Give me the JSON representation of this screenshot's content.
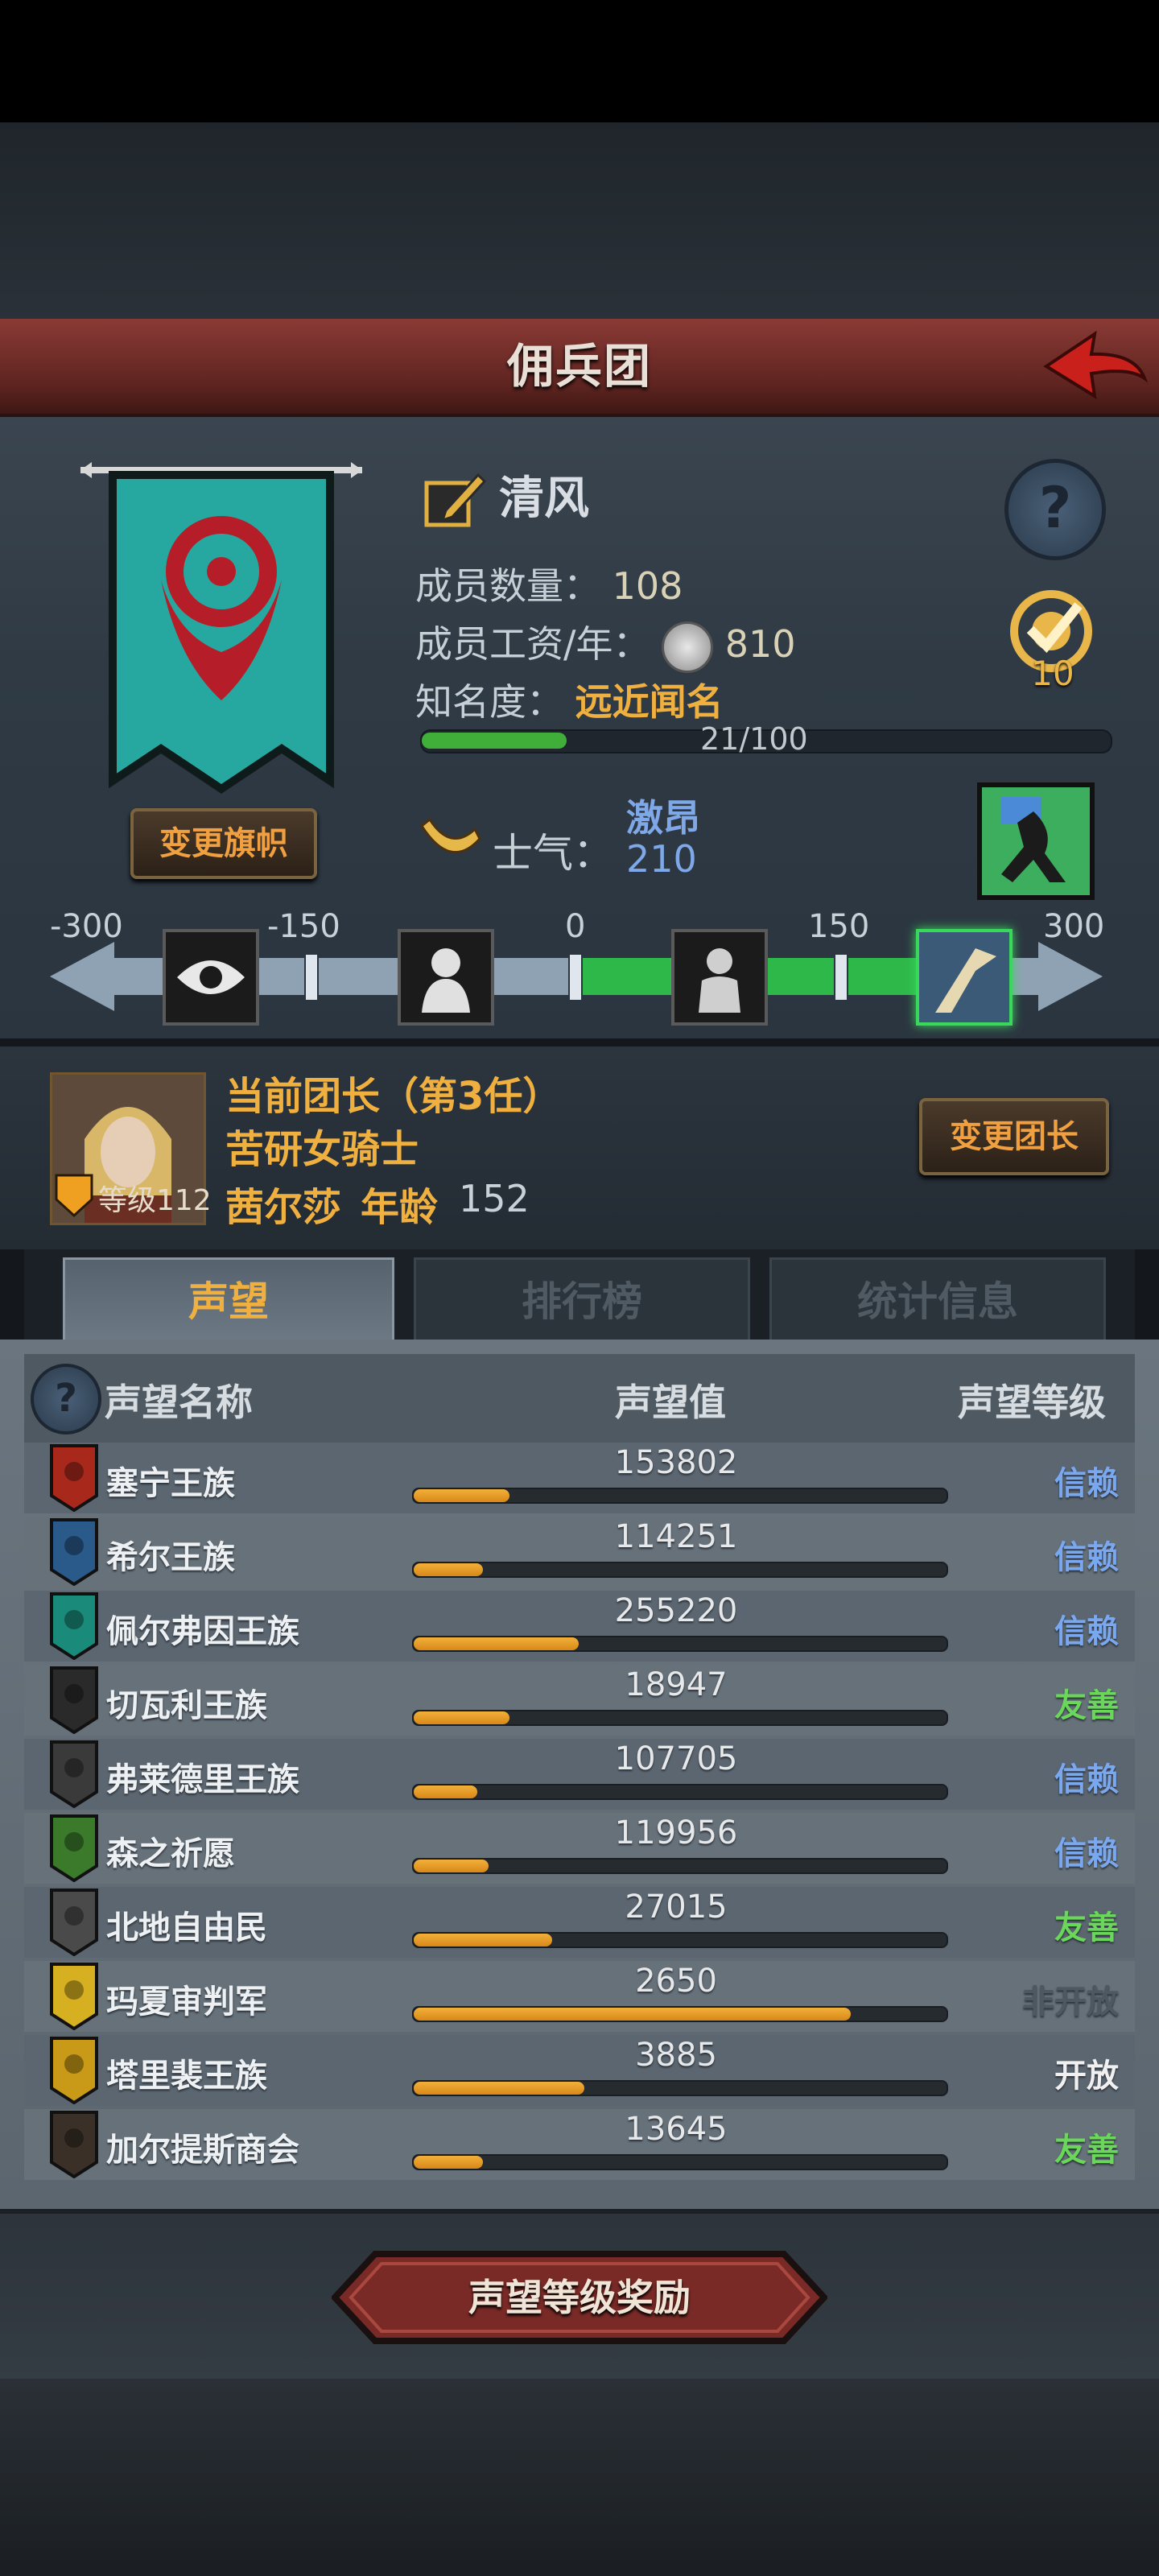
{
  "header": {
    "title": "佣兵团"
  },
  "company": {
    "name": "清风",
    "members_label": "成员数量：",
    "members": "108",
    "wage_label": "成员工资/年：",
    "wage": "810",
    "fame_label": "知名度：",
    "fame_value": "远近闻名",
    "fame_progress_text": "21/100",
    "fame_progress": 0.21,
    "task_count": "10",
    "change_flag_label": "变更旗帜"
  },
  "morale": {
    "label": "士气：",
    "state": "激昂",
    "value": "210",
    "scale_labels": [
      "-300",
      "-150",
      "0",
      "150",
      "300"
    ]
  },
  "leader": {
    "title": "当前团长（第3任）",
    "subtitle": "苦研女骑士",
    "name": "茜尔莎",
    "age_label": "年龄",
    "age": "152",
    "level": "等级112",
    "change_label": "变更团长"
  },
  "tabs": [
    {
      "label": "声望"
    },
    {
      "label": "排行榜"
    },
    {
      "label": "统计信息"
    }
  ],
  "reputation": {
    "headers": {
      "name": "声望名称",
      "value": "声望值",
      "level": "声望等级"
    },
    "rows": [
      {
        "name": "塞宁王族",
        "value": "153802",
        "level": "信赖",
        "fill": 0.18,
        "color": "#79a8f0",
        "crest_color": "#a8281c"
      },
      {
        "name": "希尔王族",
        "value": "114251",
        "level": "信赖",
        "fill": 0.13,
        "color": "#79a8f0",
        "crest_color": "#2a5a8a"
      },
      {
        "name": "佩尔弗因王族",
        "value": "255220",
        "level": "信赖",
        "fill": 0.31,
        "color": "#79a8f0",
        "crest_color": "#1a8a7a"
      },
      {
        "name": "切瓦利王族",
        "value": "18947",
        "level": "友善",
        "fill": 0.18,
        "color": "#6ad65a",
        "crest_color": "#2a2a2a"
      },
      {
        "name": "弗莱德里王族",
        "value": "107705",
        "level": "信赖",
        "fill": 0.12,
        "color": "#79a8f0",
        "crest_color": "#3a3a3a"
      },
      {
        "name": "森之祈愿",
        "value": "119956",
        "level": "信赖",
        "fill": 0.14,
        "color": "#79a8f0",
        "crest_color": "#3a7a2a"
      },
      {
        "name": "北地自由民",
        "value": "27015",
        "level": "友善",
        "fill": 0.26,
        "color": "#6ad65a",
        "crest_color": "#4a4a4a"
      },
      {
        "name": "玛夏审判军",
        "value": "2650",
        "level": "非开放",
        "fill": 0.82,
        "color": "#4e5860",
        "crest_color": "#d6b020"
      },
      {
        "name": "塔里裴王族",
        "value": "3885",
        "level": "开放",
        "fill": 0.32,
        "color": "#f0f0f0",
        "crest_color": "#c89a18"
      },
      {
        "name": "加尔提斯商会",
        "value": "13645",
        "level": "友善",
        "fill": 0.13,
        "color": "#6ad65a",
        "crest_color": "#3a3028"
      }
    ]
  },
  "footer": {
    "reward_label": "声望等级奖励"
  },
  "icons": [
    "back-arrow-icon",
    "edit-pencil-icon",
    "help-icon",
    "silver-coin-icon",
    "task-target-icon",
    "horn-icon",
    "morale-charge-icon",
    "eye-icon",
    "despair-icon",
    "calm-icon",
    "flag-charge-icon"
  ]
}
